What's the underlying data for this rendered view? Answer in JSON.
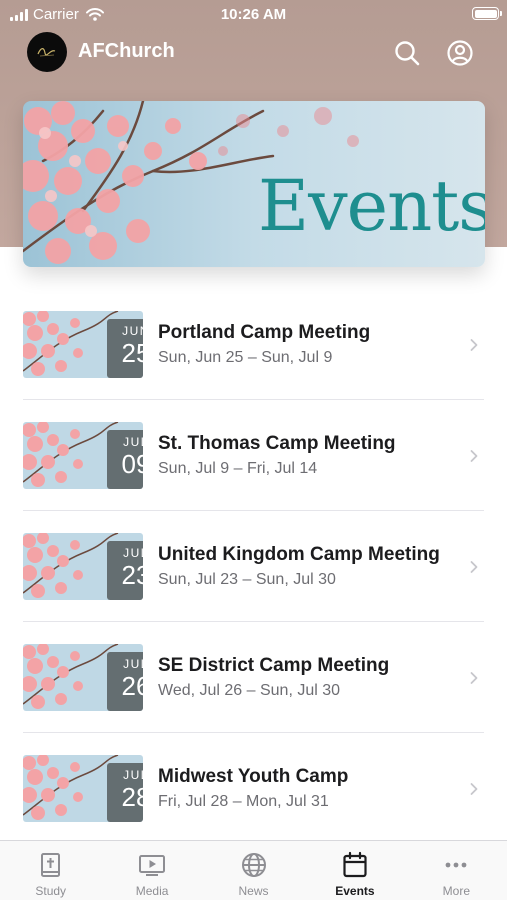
{
  "status_bar": {
    "carrier": "Carrier",
    "time": "10:26 AM"
  },
  "header": {
    "app_name": "AFChurch"
  },
  "banner": {
    "title": "Events"
  },
  "events": [
    {
      "month": "JUN",
      "day": "25",
      "title": "Portland Camp Meeting",
      "range": "Sun, Jun 25 – Sun, Jul 9"
    },
    {
      "month": "JUL",
      "day": "09",
      "title": "St. Thomas Camp Meeting",
      "range": "Sun, Jul 9 – Fri, Jul 14"
    },
    {
      "month": "JUL",
      "day": "23",
      "title": "United Kingdom Camp Meeting",
      "range": "Sun, Jul 23 – Sun, Jul 30"
    },
    {
      "month": "JUL",
      "day": "26",
      "title": "SE District Camp Meeting",
      "range": "Wed, Jul 26 – Sun, Jul 30"
    },
    {
      "month": "JUL",
      "day": "28",
      "title": "Midwest Youth Camp",
      "range": "Fri, Jul 28 – Mon, Jul 31"
    }
  ],
  "tabs": [
    {
      "label": "Study",
      "icon": "bible-icon"
    },
    {
      "label": "Media",
      "icon": "media-play-icon"
    },
    {
      "label": "News",
      "icon": "globe-icon"
    },
    {
      "label": "Events",
      "icon": "calendar-icon",
      "active": true
    },
    {
      "label": "More",
      "icon": "more-dots-icon"
    }
  ],
  "colors": {
    "header_bg": "#b59c93",
    "banner_text": "#1e8e8f",
    "blossom": "#f0a6a8",
    "sky": "#bcd7e6",
    "tab_active": "#1c1c1e",
    "tab_inactive": "#8e8e93"
  }
}
